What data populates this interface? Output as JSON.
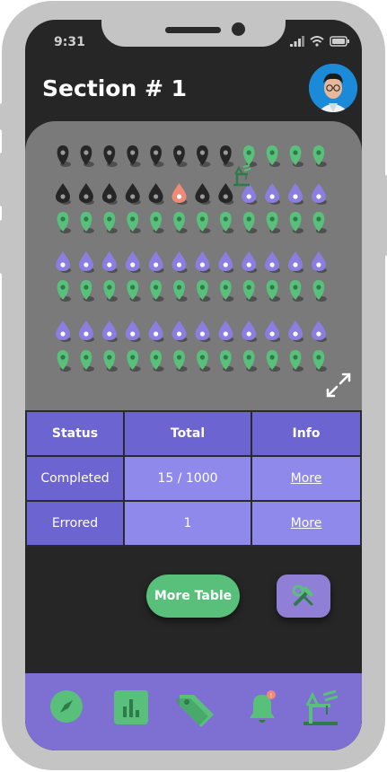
{
  "status_bar": {
    "time": "9:31"
  },
  "header": {
    "title": "Section # 1"
  },
  "map": {
    "pin_rows": [
      [
        "pin-dark",
        "pin-dark",
        "pin-dark",
        "pin-dark",
        "pin-dark",
        "pin-dark",
        "pin-dark",
        "pin-dark",
        "pin-green",
        "pin-green",
        "pin-green",
        "pin-green"
      ],
      [
        "drop-dark",
        "drop-dark",
        "drop-dark",
        "drop-dark",
        "drop-dark",
        "drop-red",
        "drop-dark",
        "drop-dark",
        "drop-purple",
        "drop-purple",
        "drop-purple",
        "drop-purple"
      ],
      [
        "pin-green",
        "pin-green",
        "pin-green",
        "pin-green",
        "pin-green",
        "pin-green",
        "pin-green",
        "pin-green",
        "pin-green",
        "pin-green",
        "pin-green",
        "pin-green"
      ],
      [
        "drop-purple",
        "drop-purple",
        "drop-purple",
        "drop-purple",
        "drop-purple",
        "drop-purple",
        "drop-purple",
        "drop-purple",
        "drop-purple",
        "drop-purple",
        "drop-purple",
        "drop-purple"
      ],
      [
        "pin-green",
        "pin-green",
        "pin-green",
        "pin-green",
        "pin-green",
        "pin-green",
        "pin-green",
        "pin-green",
        "pin-green",
        "pin-green",
        "pin-green",
        "pin-green"
      ],
      [
        "drop-purple",
        "drop-purple",
        "drop-purple",
        "drop-purple",
        "drop-purple",
        "drop-purple",
        "drop-purple",
        "drop-purple",
        "drop-purple",
        "drop-purple",
        "drop-purple",
        "drop-purple"
      ],
      [
        "pin-green",
        "pin-green",
        "pin-green",
        "pin-green",
        "pin-green",
        "pin-green",
        "pin-green",
        "pin-green",
        "pin-green",
        "pin-green",
        "pin-green",
        "pin-green"
      ]
    ],
    "colors": {
      "dark": "#262626",
      "green": "#58c07a",
      "purple": "#8b7ee0",
      "red": "#f08a78",
      "panel": "#7a7a7a"
    }
  },
  "table": {
    "headers": [
      "Status",
      "Total",
      "Info"
    ],
    "rows": [
      {
        "status": "Completed",
        "total": "15 / 1000",
        "info": "More"
      },
      {
        "status": "Errored",
        "total": "1",
        "info": "More"
      }
    ]
  },
  "actions": {
    "more_table": "More Table"
  },
  "nav": {
    "items": [
      "compass-icon",
      "chart-icon",
      "tags-icon",
      "bell-icon",
      "crane-icon"
    ],
    "accent": "#58c07a",
    "background": "#7e6fd2"
  }
}
